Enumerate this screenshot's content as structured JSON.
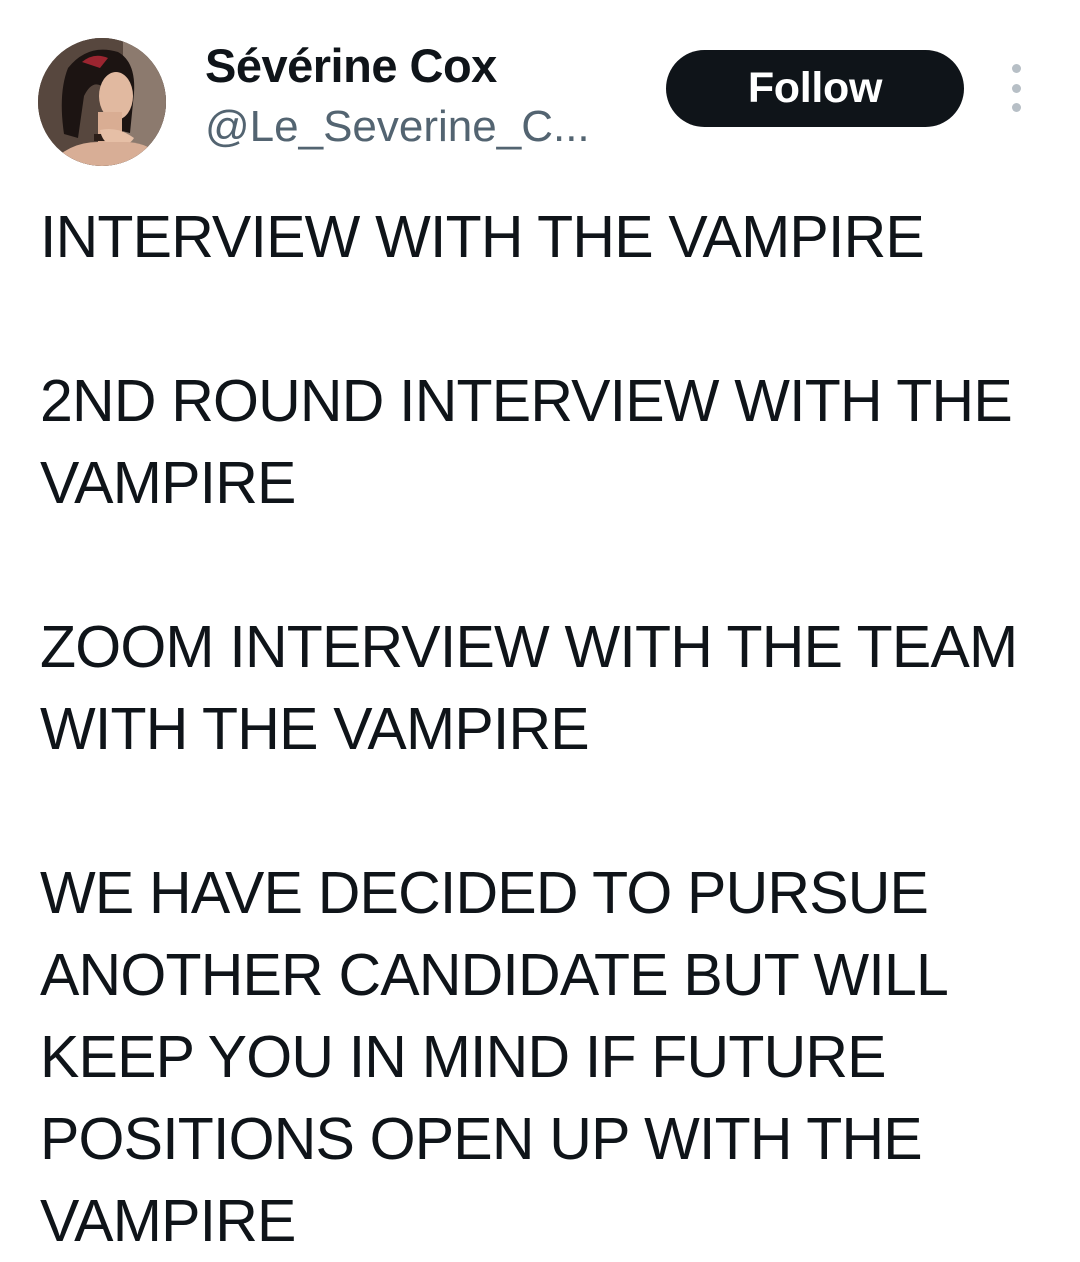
{
  "author": {
    "display_name": "Sévérine Cox",
    "handle": "@Le_Severine_C..."
  },
  "actions": {
    "follow_label": "Follow",
    "more_icon": "more-vertical-icon"
  },
  "tweet": {
    "paragraphs": [
      "INTERVIEW WITH THE VAMPIRE",
      "2ND ROUND INTERVIEW WITH THE VAMPIRE",
      "ZOOM INTERVIEW WITH THE TEAM WITH THE VAMPIRE",
      "WE HAVE DECIDED TO PURSUE ANOTHER CANDIDATE BUT WILL KEEP YOU IN MIND IF FUTURE POSITIONS OPEN UP WITH THE VAMPIRE"
    ]
  },
  "colors": {
    "text": "#0f1419",
    "secondary_text": "#536471",
    "button_bg": "#0f1419",
    "button_text": "#ffffff",
    "more_icon": "#b7bfc6"
  }
}
